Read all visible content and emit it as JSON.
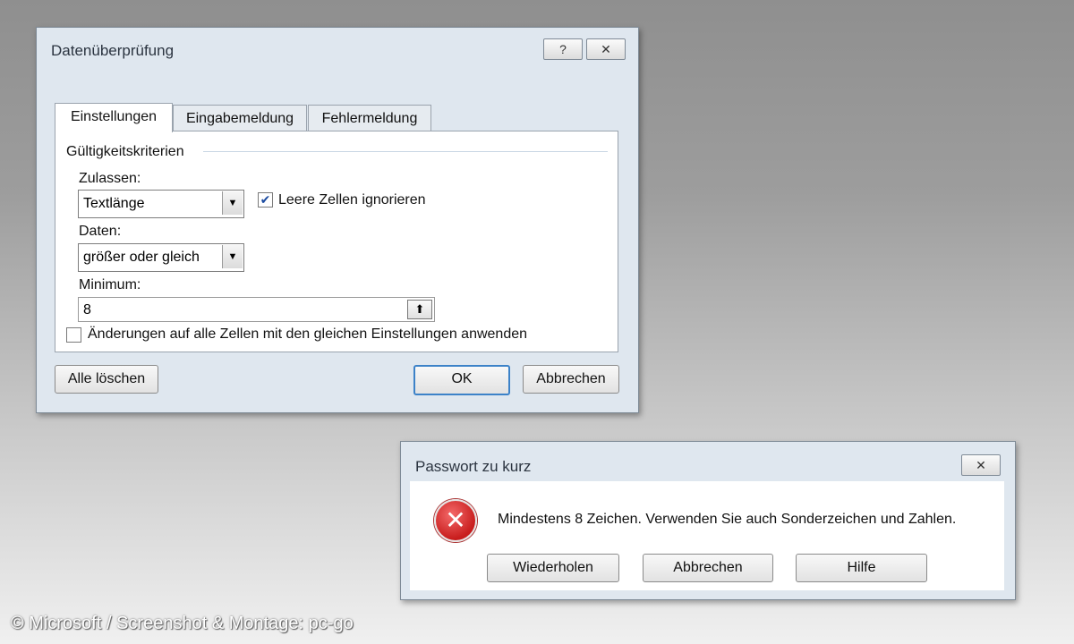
{
  "dialog_main": {
    "title": "Datenüberprüfung",
    "help_button": "?",
    "close_button": "✕",
    "tabs": [
      {
        "label": "Einstellungen"
      },
      {
        "label": "Eingabemeldung"
      },
      {
        "label": "Fehlermeldung"
      }
    ],
    "section_title": "Gültigkeitskriterien",
    "allow_label": "Zulassen:",
    "allow_value": "Textlänge",
    "ignore_blank_label": "Leere Zellen ignorieren",
    "data_label": "Daten:",
    "data_value": "größer oder gleich",
    "minimum_label": "Minimum:",
    "minimum_value": "8",
    "apply_all_label": "Änderungen auf alle Zellen mit den gleichen Einstellungen anwenden",
    "clear_all_button": "Alle löschen",
    "ok_button": "OK",
    "cancel_button": "Abbrechen"
  },
  "dialog_error": {
    "title": "Passwort zu kurz",
    "close_button": "✕",
    "message": "Mindestens 8 Zeichen. Verwenden Sie auch Sonderzeichen und Zahlen.",
    "retry_button": "Wiederholen",
    "cancel_button": "Abbrechen",
    "help_button": "Hilfe"
  },
  "credit": "© Microsoft / Screenshot & Montage: pc-go",
  "colors": {
    "accent": "#3c82c8",
    "error_icon": "#d42a2a"
  }
}
